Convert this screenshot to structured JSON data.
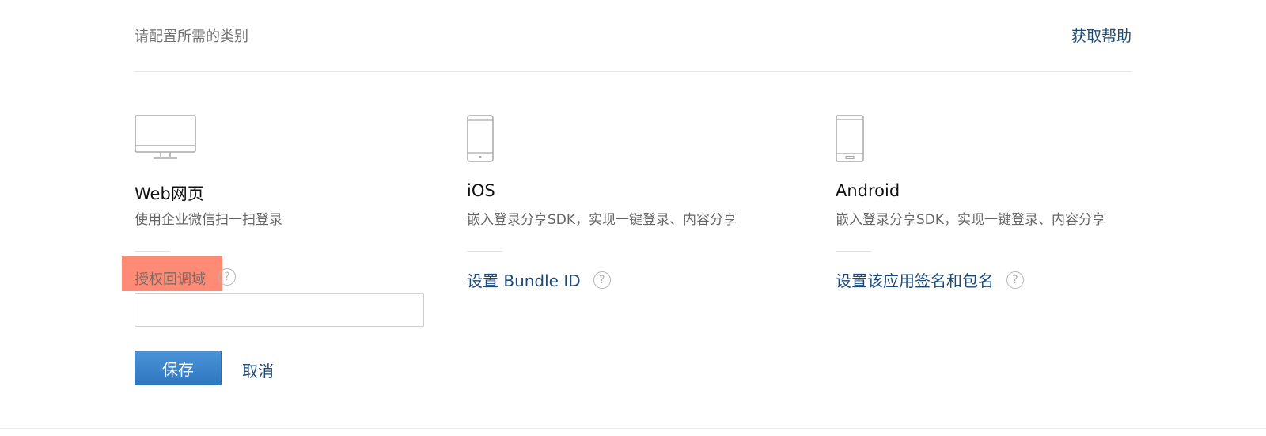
{
  "header": {
    "title": "请配置所需的类别",
    "help_link": "获取帮助"
  },
  "platforms": {
    "web": {
      "icon": "monitor-icon",
      "name": "Web网页",
      "description": "使用企业微信扫一扫登录",
      "field_label": "授权回调域",
      "field_value": "",
      "save_label": "保存",
      "cancel_label": "取消"
    },
    "ios": {
      "icon": "iphone-icon",
      "name": "iOS",
      "description": "嵌入登录分享SDK，实现一键登录、内容分享",
      "setting_link": "设置 Bundle ID"
    },
    "android": {
      "icon": "android-phone-icon",
      "name": "Android",
      "description": "嵌入登录分享SDK，实现一键登录、内容分享",
      "setting_link": "设置该应用签名和包名"
    }
  },
  "help_icon_glyph": "?",
  "colors": {
    "link": "#1c4a78",
    "primary_button": "#3a86cf",
    "highlight": "#ff8a76"
  }
}
